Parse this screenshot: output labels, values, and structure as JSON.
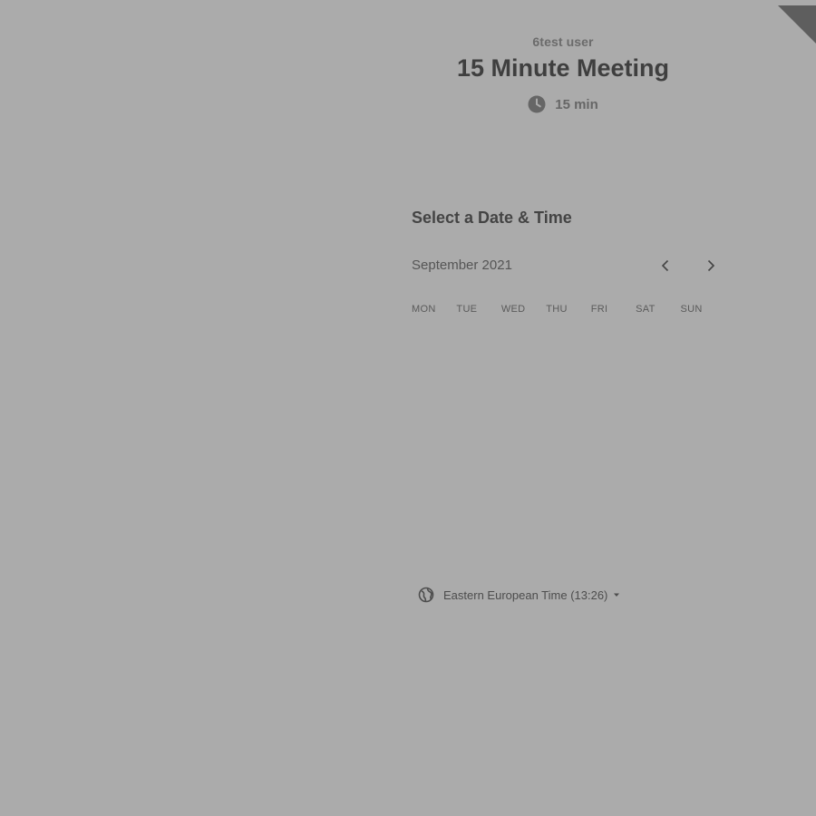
{
  "header": {
    "organizer": "6test user",
    "event_title": "15 Minute Meeting",
    "duration": "15 min",
    "duration_icon": "clock-icon"
  },
  "calendar": {
    "title": "Select a Date & Time",
    "month": "September 2021",
    "prev_icon": "chevron-left-icon",
    "next_icon": "chevron-right-icon",
    "weekdays": [
      "MON",
      "TUE",
      "WED",
      "THU",
      "FRI",
      "SAT",
      "SUN"
    ]
  },
  "timezone": {
    "label": "Eastern European Time (13:26)",
    "icon": "globe-icon",
    "dropdown_icon": "caret-down-icon"
  },
  "colors": {
    "background": "#ababab",
    "text_dark": "#3f3f3f",
    "text_muted": "#6b6b6b",
    "corner_badge": "#5e5e5e"
  }
}
